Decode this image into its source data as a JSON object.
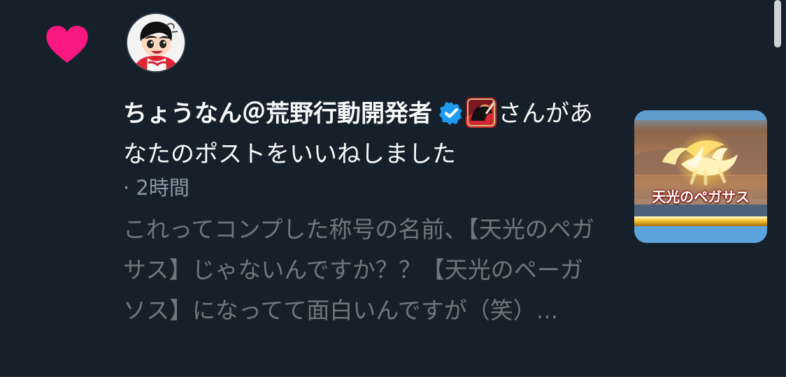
{
  "notification": {
    "type_icon": "heart-icon",
    "avatar_icon": "user-avatar-cartoon-icon",
    "actor_name": "ちょうなん＠荒野行動開発者",
    "verified_icon": "verified-badge-icon",
    "game_badge_icon": "game-app-icon",
    "action_text": "さんがあなたのポストをいいねしました",
    "time_text": "· 2時間",
    "preview_text": "これってコンプした称号の名前、【天光のペガサス】じゃないんですか？？【天光のペーガソス】になってて面白いんですが（笑）...",
    "media": {
      "image_label": "天光のペガサス"
    }
  },
  "colors": {
    "background": "#15202b",
    "heart": "#f91880",
    "primary_text": "#f7f9f9",
    "secondary_text": "#71767b",
    "verified": "#1d9bf0"
  }
}
